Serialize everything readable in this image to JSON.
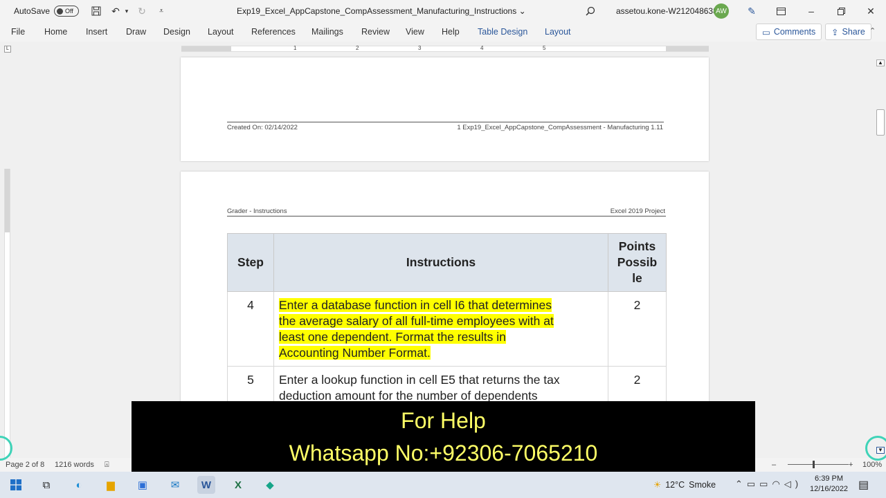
{
  "titlebar": {
    "autosave_label": "AutoSave",
    "autosave_state": "Off",
    "document_title": "Exp19_Excel_AppCapstone_CompAssessment_Manufacturing_Instructions",
    "account": "assetou.kone-W212048638",
    "avatar_initials": "AW"
  },
  "ribbon": {
    "tabs": [
      "File",
      "Home",
      "Insert",
      "Draw",
      "Design",
      "Layout",
      "References",
      "Mailings",
      "Review",
      "View",
      "Help",
      "Table Design",
      "Layout"
    ],
    "comments_label": "Comments",
    "share_label": "Share"
  },
  "ruler": {
    "numbers": [
      "1",
      "2",
      "3",
      "4",
      "5"
    ]
  },
  "page1": {
    "footer_left": "Created On: 02/14/2022",
    "footer_right": "1  Exp19_Excel_AppCapstone_CompAssessment - Manufacturing 1.11"
  },
  "page2": {
    "header_left": "Grader - Instructions",
    "header_right": "Excel 2019 Project",
    "table": {
      "headers": {
        "step": "Step",
        "instructions": "Instructions",
        "points_1": "Points",
        "points_2": "Possib",
        "points_3": "le"
      },
      "rows": [
        {
          "step": "4",
          "instructions_lines": [
            "Enter a database function in cell I6 that determines",
            "the average salary of all full-time employees with at",
            "least one dependent. Format the results in",
            "Accounting Number Format."
          ],
          "points": "2",
          "highlighted": true
        },
        {
          "step": "5",
          "instructions_lines": [
            "Enter a lookup function in cell E5 that returns the tax",
            "deduction amount for the number of dependents"
          ],
          "points": "2",
          "highlighted": false
        }
      ]
    }
  },
  "statusbar": {
    "page_info": "Page 2 of 8",
    "word_count": "1216 words",
    "zoom": "100%"
  },
  "overlay": {
    "line1": "For Help",
    "line2": "Whatsapp No:+92306-7065210"
  },
  "taskbar": {
    "temperature": "12°C",
    "weather": "Smoke",
    "time": "6:39 PM",
    "date": "12/16/2022"
  },
  "colors": {
    "highlight": "#ffff00",
    "table_header_bg": "#dde4ec",
    "accent": "#2b579a",
    "overlay_text": "#ffff66"
  }
}
